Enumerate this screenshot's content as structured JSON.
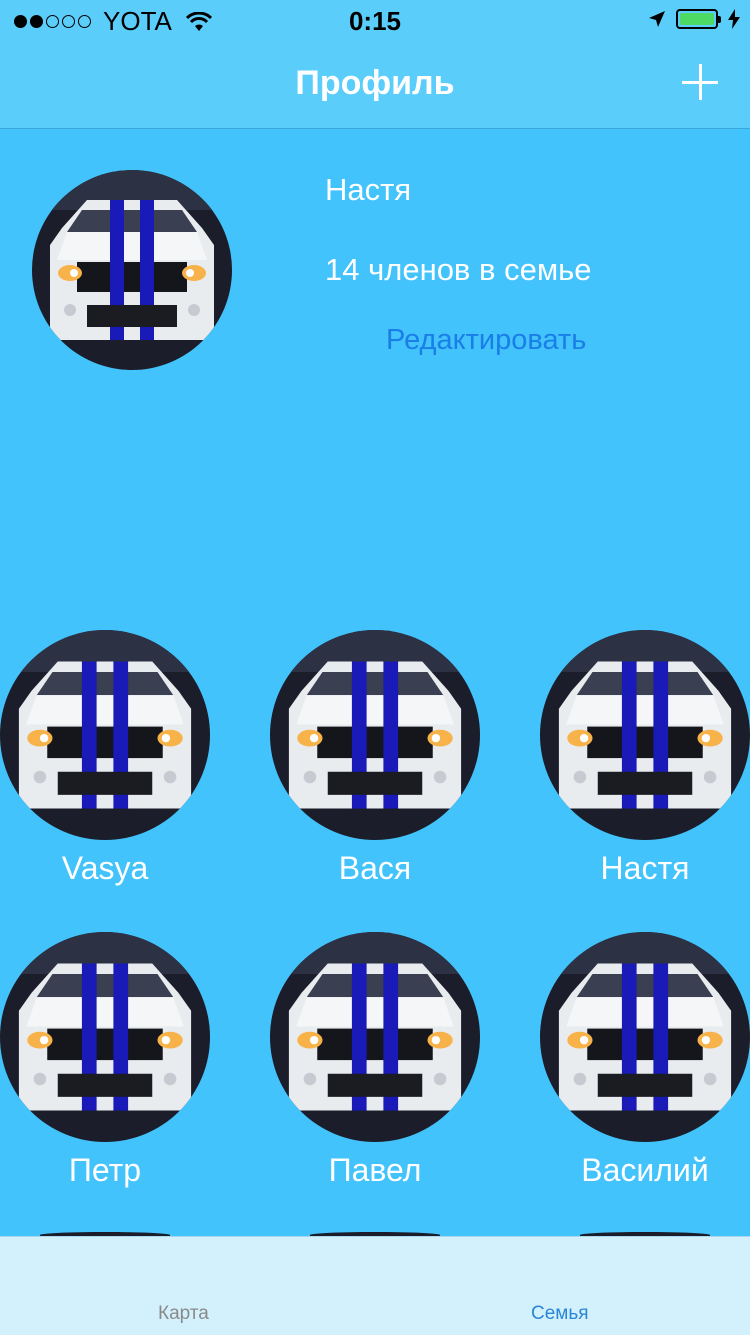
{
  "status_bar": {
    "signal_dots": [
      true,
      true,
      false,
      false,
      false
    ],
    "carrier": "YOTA",
    "time": "0:15"
  },
  "nav": {
    "title": "Профиль",
    "add_icon": "plus-icon"
  },
  "profile": {
    "name": "Настя",
    "family_count": "14 членов в семье",
    "edit_label": "Редактировать"
  },
  "members": [
    {
      "name": "Vasya"
    },
    {
      "name": "Вася"
    },
    {
      "name": "Настя"
    },
    {
      "name": "Петр"
    },
    {
      "name": "Павел"
    },
    {
      "name": "Василий"
    }
  ],
  "tabs": [
    {
      "label": "Карта",
      "active": false
    },
    {
      "label": "Семья",
      "active": true
    }
  ],
  "colors": {
    "background": "#43c3fb",
    "nav_bar": "#5acdfa",
    "tab_bar": "#d3f1fd",
    "link": "#1a7ee8",
    "active_tab": "#2a86d8",
    "inactive_tab": "#8a8a8a"
  }
}
